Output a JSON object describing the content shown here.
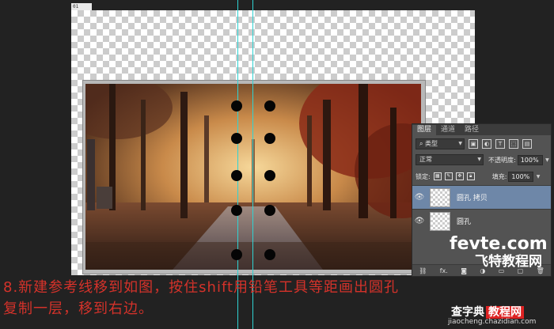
{
  "document_tab": "01",
  "guides": {
    "color": "#2fd3d3"
  },
  "dots": {
    "color": "#050505",
    "columns": [
      "left",
      "right"
    ],
    "count_per_column": 5
  },
  "layers_panel": {
    "tabs": [
      "图层",
      "通道",
      "路径"
    ],
    "active_tab": "图层",
    "filter_select": "类型",
    "filter_icons": [
      "image-filter-icon",
      "adjustment-filter-icon",
      "type-filter-icon",
      "shape-filter-icon",
      "smart-object-filter-icon"
    ],
    "blend_mode": "正常",
    "opacity_label": "不透明度:",
    "opacity_value": "100%",
    "lock_label": "锁定:",
    "fill_label": "填充:",
    "fill_value": "100%",
    "layers": [
      {
        "name": "圆孔 拷贝",
        "visible": true,
        "selected": true
      },
      {
        "name": "圆孔",
        "visible": true,
        "selected": false
      }
    ],
    "bottom_icons": [
      "link-icon",
      "fx-icon",
      "mask-icon",
      "adjustment-icon",
      "group-icon",
      "new-layer-icon",
      "trash-icon"
    ],
    "fx_label": "fx."
  },
  "caption": {
    "line1": "8.新建参考线移到如图，按住shift用铅笔工具等距画出圆孔",
    "line2": "复制一层，移到右边。",
    "color": "#d4322a"
  },
  "watermarks": {
    "fevte": "fevte.com",
    "fevte_cn": "飞特教程网",
    "chazidian": "查字典",
    "chazidian_badge": "教程网",
    "url": "jiaocheng.chazidian.com"
  }
}
